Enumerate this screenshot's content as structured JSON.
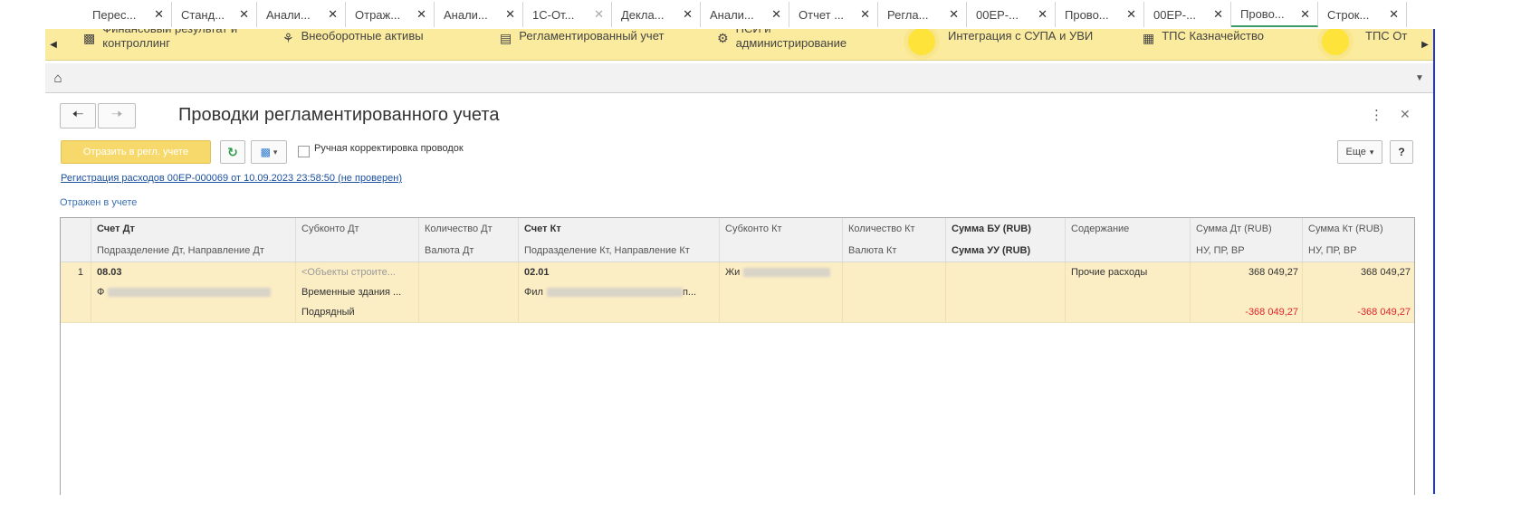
{
  "sections": {
    "items": [
      {
        "label": "Финансовый результат и контроллинг",
        "icon": "bar-chart-icon"
      },
      {
        "label": "Внеоборотные активы",
        "icon": "assets-icon"
      },
      {
        "label": "Регламентированный учет",
        "icon": "document-icon"
      },
      {
        "label": "НСИ и администрирование",
        "icon": "gear-icon"
      },
      {
        "label": "Интеграция с СУПА и УВИ",
        "icon": "sun-icon"
      },
      {
        "label": "ТПС Казначейство",
        "icon": "table-icon"
      },
      {
        "label": "ТПС От",
        "icon": "sun-icon"
      }
    ]
  },
  "tabs": [
    {
      "label": "Перес..."
    },
    {
      "label": "Станд..."
    },
    {
      "label": "Анали..."
    },
    {
      "label": "Отраж..."
    },
    {
      "label": "Анали..."
    },
    {
      "label": "1С-От..."
    },
    {
      "label": "Декла..."
    },
    {
      "label": "Анали..."
    },
    {
      "label": "Отчет ..."
    },
    {
      "label": "Регла..."
    },
    {
      "label": "00ЕР-..."
    },
    {
      "label": "Прово..."
    },
    {
      "label": "00ЕР-..."
    },
    {
      "label": "Прово..."
    },
    {
      "label": "Строк..."
    }
  ],
  "form": {
    "title": "Проводки регламентированного учета",
    "reflect_button": "Отразить в регл. учете",
    "manual_correction_label": "Ручная корректировка проводок",
    "more_button": "Еще",
    "help_button": "?",
    "document_link": "Регистрация расходов 00ЕР-000069 от 10.09.2023 23:58:50 (не проверен)",
    "status": "Отражен в учете"
  },
  "grid": {
    "header_row1": [
      "Счет Дт",
      "Субконто Дт",
      "Количество Дт",
      "Счет Кт",
      "Субконто Кт",
      "Количество Кт",
      "Сумма БУ (RUB)",
      "Содержание",
      "Сумма Дт (RUB)",
      "Сумма Кт (RUB)"
    ],
    "header_row2": [
      "Подразделение Дт, Направление Дт",
      "",
      "Валюта Дт",
      "Подразделение Кт, Направление Кт",
      "",
      "Валюта Кт",
      "Сумма УУ (RUB)",
      "",
      "НУ, ПР, ВР",
      "НУ, ПР, ВР"
    ],
    "rows": [
      {
        "n": "1",
        "line1": {
          "account_dt": "08.03",
          "subconto_dt": "<Объекты строите...",
          "account_kt": "02.01",
          "subconto_kt": "Жи",
          "content": "Прочие расходы",
          "sum_dt": "368 049,27",
          "sum_kt": "368 049,27"
        },
        "line2": {
          "dept_dt": "Ф",
          "subconto_dt": "Временные здания ...",
          "dept_kt": "Фил",
          "dept_kt_tail": "п..."
        },
        "line3": {
          "subconto_dt": "Подрядный",
          "sum_dt": "-368 049,27",
          "sum_kt": "-368 049,27"
        }
      }
    ]
  }
}
